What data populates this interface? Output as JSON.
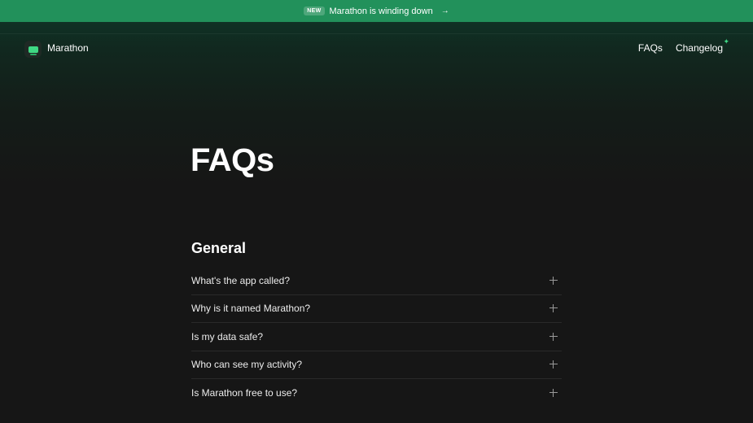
{
  "banner": {
    "badge": "NEW",
    "text": "Marathon is winding down",
    "arrow_icon": "arrow-right-icon"
  },
  "nav": {
    "brand": "Marathon",
    "logo_icon": "marathon-logo-icon",
    "links": [
      {
        "label": "FAQs"
      },
      {
        "label": "Changelog"
      }
    ],
    "sparkle_icon": "sparkle-icon"
  },
  "hero": {
    "title": "FAQs"
  },
  "section": {
    "title": "General",
    "items": [
      {
        "question": "What's the app called?"
      },
      {
        "question": "Why is it named Marathon?"
      },
      {
        "question": "Is my data safe?"
      },
      {
        "question": "Who can see my activity?"
      },
      {
        "question": "Is Marathon free to use?"
      }
    ]
  },
  "colors": {
    "banner_bg": "#22915b",
    "accent": "#3fd884",
    "page_bg": "#161616"
  }
}
